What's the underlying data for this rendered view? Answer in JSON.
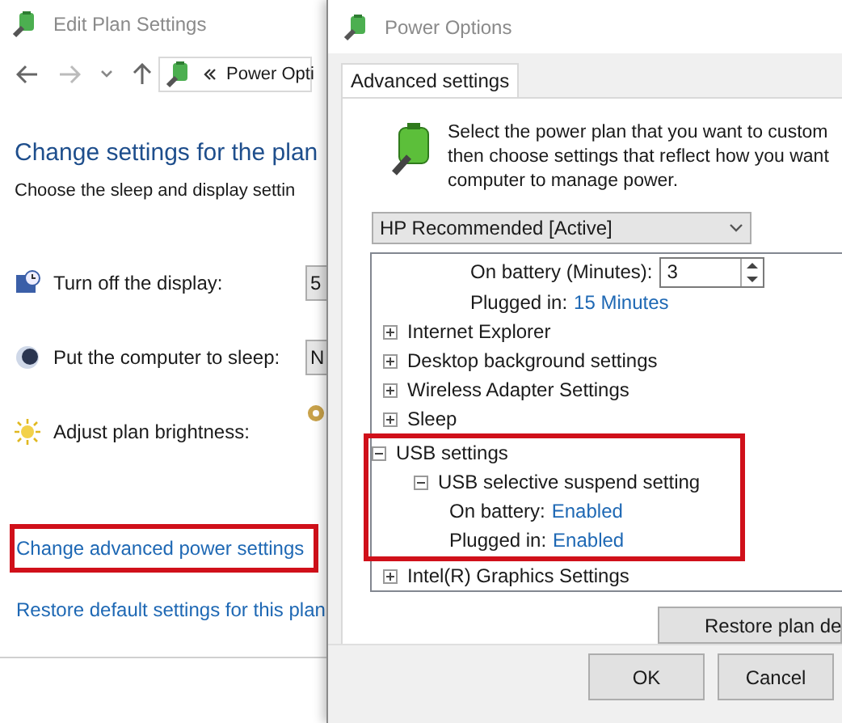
{
  "back_window": {
    "title": "Edit Plan Settings",
    "address": "Power Opti",
    "heading": "Change settings for the plan",
    "subheading": "Choose the sleep and display settin",
    "settings": [
      {
        "kind": "combo",
        "label": "Turn off the display:",
        "value": "5"
      },
      {
        "kind": "combo",
        "label": "Put the computer to sleep:",
        "value": "N"
      },
      {
        "kind": "slider",
        "label": "Adjust plan brightness:"
      }
    ],
    "links": [
      {
        "label": "Change advanced power settings",
        "highlighted": true
      },
      {
        "label": "Restore default settings for this plan",
        "highlighted": false
      }
    ]
  },
  "dialog": {
    "title": "Power Options",
    "tabs": [
      {
        "label": "Advanced settings",
        "selected": true
      }
    ],
    "description": [
      "Select the power plan that you want to custom",
      "then choose settings that reflect how you want",
      "computer to manage power."
    ],
    "plan": "HP Recommended [Active]",
    "tree": [
      {
        "kind": "spin",
        "label": "On battery (Minutes):",
        "value": "3"
      },
      {
        "kind": "value",
        "label": "Plugged in:",
        "value": "15 Minutes"
      },
      {
        "kind": "node",
        "label": "Internet Explorer",
        "expanded": false,
        "highlighted": false
      },
      {
        "kind": "node",
        "label": "Desktop background settings",
        "expanded": false,
        "highlighted": false
      },
      {
        "kind": "node",
        "label": "Wireless Adapter Settings",
        "expanded": false,
        "highlighted": false
      },
      {
        "kind": "node",
        "label": "Sleep",
        "expanded": false,
        "highlighted": false
      },
      {
        "kind": "node",
        "label": "USB settings",
        "expanded": true,
        "highlighted": true,
        "children": [
          {
            "kind": "node",
            "label": "USB selective suspend setting",
            "expanded": true,
            "highlighted": false,
            "children": [
              {
                "kind": "value",
                "label": "On battery:",
                "value": "Enabled"
              },
              {
                "kind": "value",
                "label": "Plugged in:",
                "value": "Enabled"
              }
            ]
          }
        ]
      },
      {
        "kind": "node",
        "label": "Intel(R) Graphics Settings",
        "expanded": false,
        "highlighted": false
      }
    ],
    "restore_button": "Restore plan de",
    "buttons": [
      "OK",
      "Cancel"
    ]
  }
}
